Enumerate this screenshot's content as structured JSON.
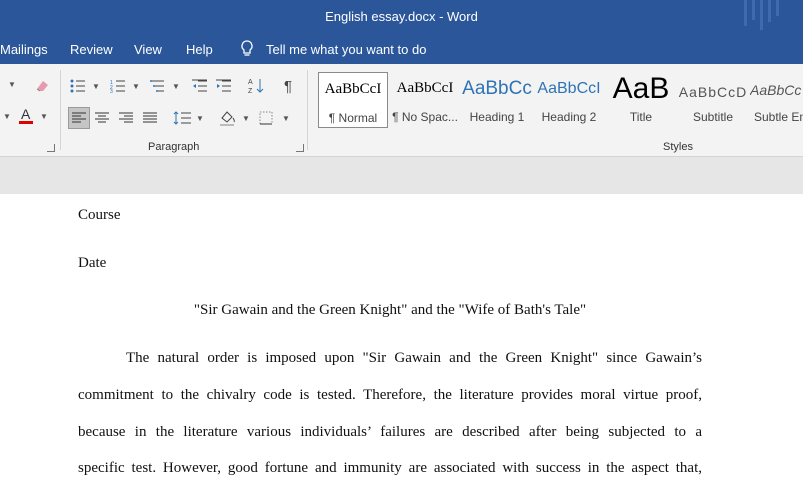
{
  "window": {
    "title": "English essay.docx  -  Word"
  },
  "tabs": [
    {
      "label": "Mailings"
    },
    {
      "label": "Review"
    },
    {
      "label": "View"
    },
    {
      "label": "Help"
    }
  ],
  "tell_me": {
    "placeholder": "Tell me what you want to do",
    "icon": "lightbulb-icon"
  },
  "groups": {
    "paragraph": "Paragraph",
    "styles": "Styles"
  },
  "styles": [
    {
      "preview": "AaBbCcI",
      "label": "¶ Normal"
    },
    {
      "preview": "AaBbCcI",
      "label": "¶ No Spac..."
    },
    {
      "preview": "AaBbCc",
      "label": "Heading 1"
    },
    {
      "preview": "AaBbCcI",
      "label": "Heading 2"
    },
    {
      "preview": "AaB",
      "label": "Title"
    },
    {
      "preview": "AaBbCcD",
      "label": "Subtitle"
    },
    {
      "preview": "AaBbCc",
      "label": "Subtle Em"
    }
  ],
  "colors": {
    "ribbon_blue": "#2b579a",
    "heading_blue": "#2e74b5",
    "font_color_red": "#e00000"
  },
  "document": {
    "course": "Course",
    "date": "Date",
    "title": "\"Sir Gawain and the Green Knight\" and the \"Wife of Bath's Tale\"",
    "lines": [
      "The natural order is imposed upon \"Sir Gawain and the Green Knight\" since Gawain’s",
      "commitment to the chivalry code is tested. Therefore, the literature provides moral virtue proof,",
      "because in the literature various individuals’ failures are described after being subjected to a",
      "specific test. However, good fortune and immunity are associated with success in the aspect that,"
    ]
  }
}
